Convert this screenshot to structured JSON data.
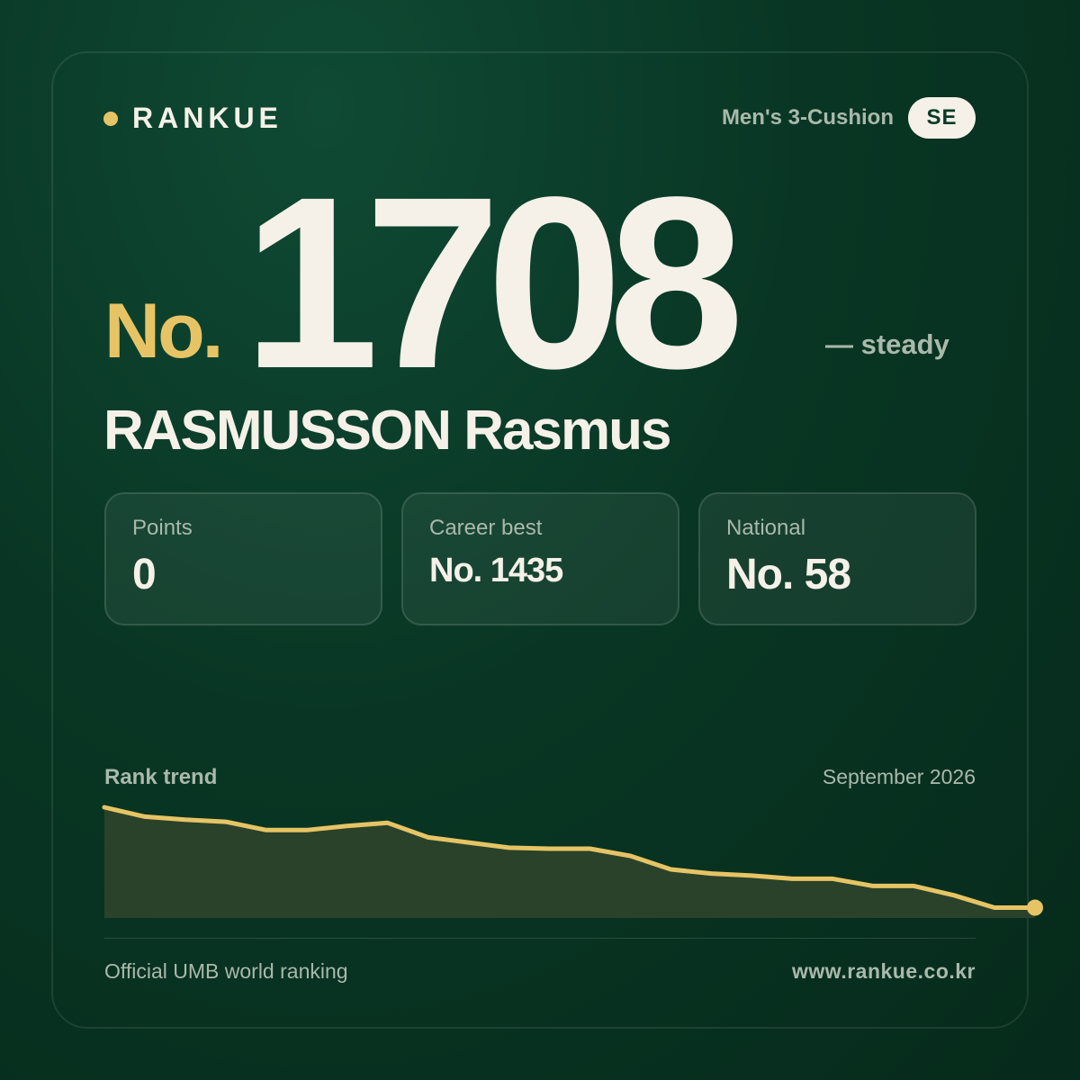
{
  "brand": {
    "name": "RANKUE",
    "accent_color": "#e6c465"
  },
  "header": {
    "category": "Men's 3-Cushion",
    "country_code": "SE"
  },
  "rank": {
    "prefix": "No.",
    "number": "1708",
    "change": "— steady"
  },
  "player": {
    "name": "RASMUSSON Rasmus"
  },
  "stats": [
    {
      "label": "Points",
      "value": "0"
    },
    {
      "label": "Career best",
      "value": "No. 1435"
    },
    {
      "label": "National",
      "value": "No. 58"
    }
  ],
  "trend": {
    "label": "Rank trend",
    "date": "September 2026"
  },
  "chart_data": {
    "type": "area",
    "line_color": "#e6c465",
    "fill_color": "#2a4229",
    "values": [
      0,
      0.09,
      0.12,
      0.14,
      0.22,
      0.22,
      0.18,
      0.15,
      0.29,
      0.34,
      0.39,
      0.4,
      0.4,
      0.47,
      0.6,
      0.64,
      0.66,
      0.69,
      0.69,
      0.76,
      0.76,
      0.85,
      0.97,
      0.97
    ]
  },
  "footer": {
    "source": "Official UMB world ranking",
    "url": "www.rankue.co.kr"
  }
}
